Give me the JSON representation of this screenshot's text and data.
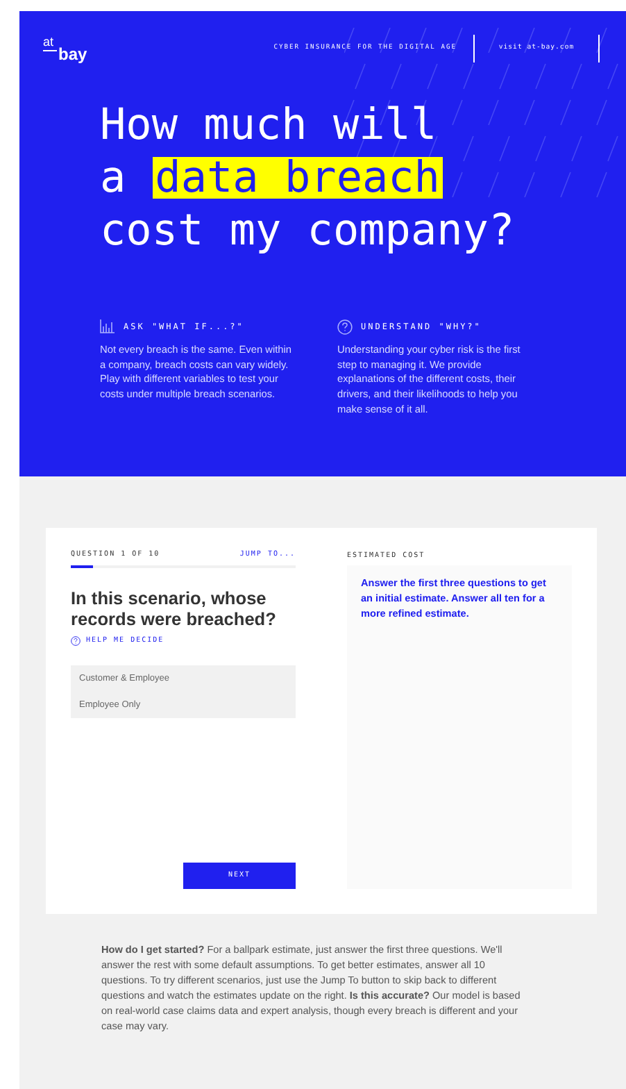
{
  "header": {
    "logo_top": "at",
    "logo_bottom": "bay",
    "tagline": "CYBER INSURANCE FOR THE DIGITAL AGE",
    "visit_link": "visit at-bay.com"
  },
  "hero": {
    "title_lines": [
      [
        {
          "text": "How much will",
          "highlighted": false
        }
      ],
      [
        {
          "text": "a",
          "highlighted": false
        },
        {
          "text": "data breach",
          "highlighted": true
        }
      ],
      [
        {
          "text": "cost my company?",
          "highlighted": false
        }
      ]
    ],
    "features": [
      {
        "kind": "chart",
        "title": "ASK \"WHAT IF...?\"",
        "body": "Not every breach is the same. Even within a company, breach costs can vary widely. Play with different variables to test your costs under multiple breach scenarios."
      },
      {
        "kind": "question",
        "title": "UNDERSTAND \"WHY?\"",
        "body": "Understanding your cyber risk is the first step to managing it. We provide explanations of the different costs, their drivers, and their likelihoods to help you make sense of it all."
      }
    ]
  },
  "quiz": {
    "progress_label": "QUESTION 1 OF 10",
    "jump_link": "JUMP TO...",
    "progress": {
      "level": 0.1
    },
    "question": "In this scenario, whose records were breached?",
    "help_link": "HELP ME DECIDE",
    "options": [
      {
        "label": "Customer & Employee",
        "selected": false
      },
      {
        "label": "Employee Only",
        "selected": false
      }
    ],
    "next_button": "NEXT"
  },
  "estimate": {
    "heading": "ESTIMATED COST",
    "message": "Answer the first three questions to get an initial estimate. Answer all ten for a more refined estimate."
  },
  "footer_text": "**How do I get started?** For a ballpark estimate, just answer the first three questions. We'll answer the rest with some default assumptions. To get better estimates, answer all 10 questions. To try different scenarios, just use the Jump To button to skip back to different questions and watch the estimates update on the right. **Is this accurate?** Our model is based on real-world case claims data and expert analysis, though every breach is different and your case may vary."
}
